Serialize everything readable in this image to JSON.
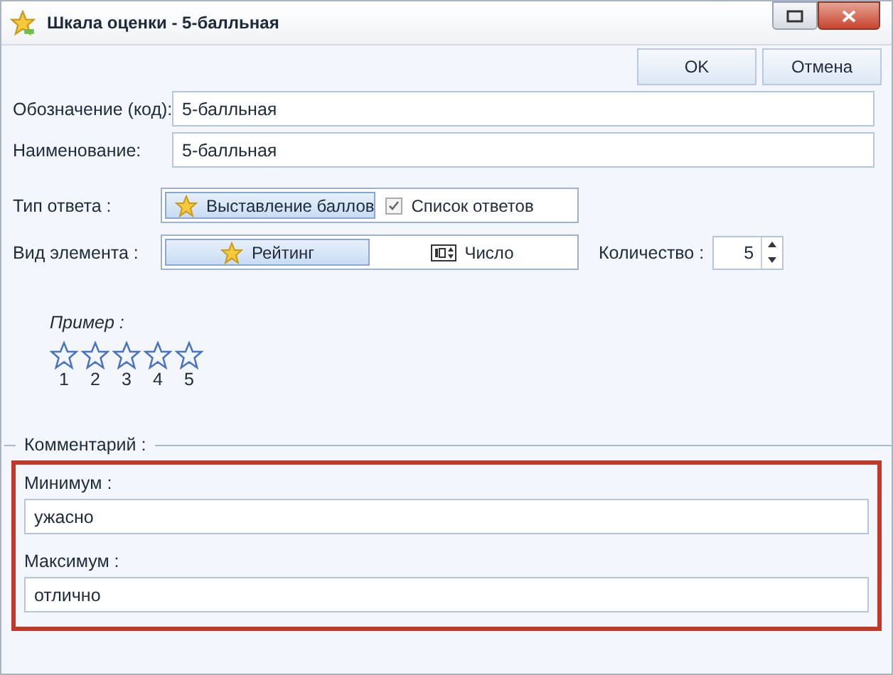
{
  "window": {
    "title": "Шкала оценки - 5-балльная"
  },
  "toolbar": {
    "buttons": [
      "OK",
      "Отмена"
    ]
  },
  "fields": [
    {
      "label": "Обозначение (код):",
      "value": "5-балльная"
    },
    {
      "label": "Наименование:",
      "value": "5-балльная"
    }
  ],
  "answer_type": {
    "label": "Тип ответа :",
    "options": [
      {
        "label": "Выставление баллов",
        "kind": "star",
        "selected": true
      },
      {
        "label": "Список ответов",
        "kind": "checkbox",
        "selected": false
      }
    ]
  },
  "element_type": {
    "label": "Вид элемента :",
    "options": [
      {
        "label": "Рейтинг",
        "kind": "star",
        "selected": true
      },
      {
        "label": "Число",
        "kind": "number",
        "selected": false
      }
    ]
  },
  "quantity": {
    "label": "Количество :",
    "value": "5"
  },
  "example": {
    "label": "Пример :",
    "stars": 0,
    "numbers": [
      "1",
      "2",
      "3",
      "4",
      "5"
    ]
  },
  "comment": {
    "title": "Комментарий :",
    "fields": [
      {
        "label": "Минимум :",
        "value": "ужасно"
      },
      {
        "label": "Максимум :",
        "value": "отлично"
      }
    ]
  }
}
